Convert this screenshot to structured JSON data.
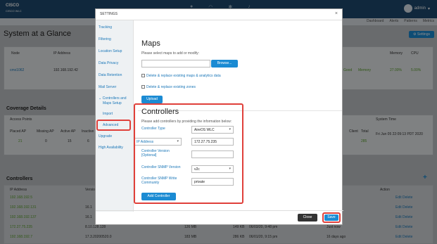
{
  "header": {
    "brand_line1": "CISCO",
    "brand_line2": "CISCO WLC",
    "user": "admin"
  },
  "subnav": [
    "Dashboard",
    "Alerts",
    "Patterns",
    "Metrics"
  ],
  "page": {
    "title": "System at a Glance",
    "settings_label": "⚙ Settings"
  },
  "bg_sections": {
    "coverage": "Coverage Details",
    "controllers": "Controllers",
    "node_header": [
      "Node",
      "IP Address"
    ],
    "node_row": [
      "cmx1062",
      "192.168.192.42"
    ],
    "memory": [
      "Memory",
      "CPU"
    ],
    "memory_vals": [
      "27.00%",
      "5.00%"
    ],
    "health": [
      "Good",
      "Memory"
    ],
    "coverage_headers": [
      "Placed AP",
      "Missing AP",
      "Active AP",
      "Inactive"
    ],
    "coverage_vals": [
      "21",
      "0",
      "15",
      "6"
    ],
    "access_points": "Access Points",
    "system_time": "System Time",
    "system_time_val": "Fri Jun 05 22:09:13 PDT 2020",
    "client_headers": [
      "Client",
      "Total"
    ],
    "client_vals": [
      "",
      "285"
    ],
    "ctrl_headers": [
      "IP Address",
      "Version",
      "Action"
    ],
    "ctrl_rows": [
      {
        "ip": "192.168.192.5",
        "ver": "",
        "size": "",
        "size2": "",
        "date": "",
        "action": "Edit Delete"
      },
      {
        "ip": "192.168.192.131",
        "ver": "16.1",
        "size": "",
        "size2": "",
        "date": "",
        "action": "Edit Delete"
      },
      {
        "ip": "192.168.192.137",
        "ver": "16.1",
        "size": "",
        "size2": "",
        "date": "",
        "action": "Edit Delete"
      },
      {
        "ip": "172.27.75.235",
        "ver": "8.10.128.128",
        "size": "126 MB",
        "size2": "149 KB",
        "date": "06/03/20, 9:48 pm",
        "time": "Just now",
        "action": "Edit Delete"
      },
      {
        "ip": "192.168.192.7",
        "ver": "17.3.20200520.0",
        "size": "183 MB",
        "size2": "286 KB",
        "date": "06/01/20, 9:15 pm",
        "time": "16 days ago",
        "action": "Edit Delete"
      }
    ]
  },
  "modal": {
    "title": "SETTINGS",
    "close": "×",
    "sidebar": [
      "Tracking",
      "Filtering",
      "Location Setup",
      "Data Privacy",
      "Data Retention",
      "Mail Server",
      "⌄ Controllers and",
      "Maps Setup",
      "Import",
      "Advanced",
      "Upgrade",
      "High Availability"
    ],
    "maps": {
      "heading": "Maps",
      "hint": "Please select maps to add or modify:",
      "browse": "Browse...",
      "opt1": "Delete & replace existing maps & analytics data",
      "opt2": "Delete & replace existing zones",
      "upload": "Upload"
    },
    "controllers": {
      "heading": "Controllers",
      "hint": "Please add controllers by providing the information below:",
      "type_label": "Controller Type",
      "type_value": "AireOS WLC",
      "addr_type": "IP Address",
      "addr_value": "172.27.75.235",
      "version_label_1": "Controller Version",
      "version_label_2": "[Optional]",
      "snmp_version_label": "Controller SNMP Version",
      "snmp_version_value": "v2c",
      "snmp_community_label_1": "Controller SNMP Write",
      "snmp_community_label_2": "Community",
      "snmp_community_value": "private",
      "add": "Add Controller"
    },
    "footer": {
      "close": "Close",
      "save": "Save"
    }
  }
}
